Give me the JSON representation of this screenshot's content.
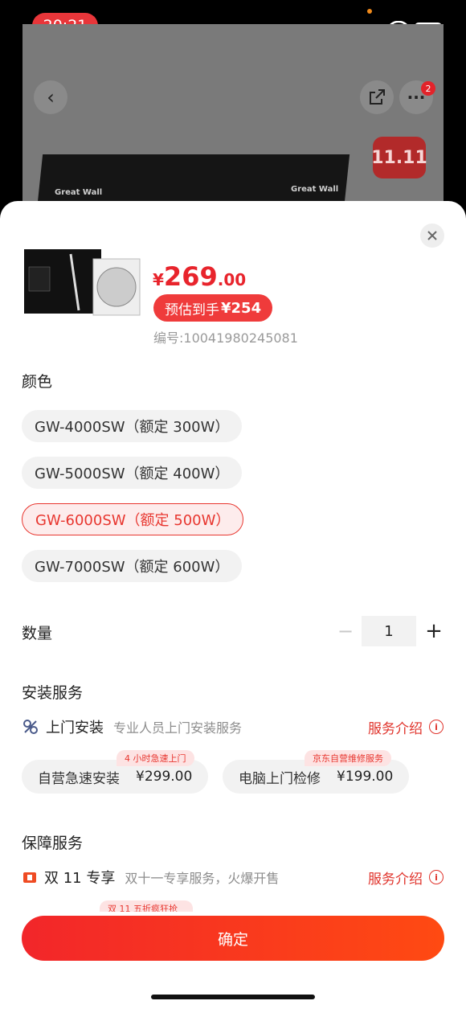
{
  "status_bar": {
    "time": "20:21"
  },
  "background_page": {
    "more_badge_count": "2",
    "promo_badge": "11.11",
    "box_brand_left": "Great Wall",
    "box_brand_right": "Great Wall"
  },
  "product": {
    "price_symbol": "¥",
    "price_integer": "269",
    "price_decimal": ".00",
    "estimate_label": "预估到手",
    "estimate_value": "¥254",
    "sku_number": "编号:10041980245081"
  },
  "color_section": {
    "title": "颜色",
    "options": [
      {
        "label": "GW-4000SW（额定 300W）",
        "selected": false
      },
      {
        "label": "GW-5000SW（额定 400W）",
        "selected": false
      },
      {
        "label": "GW-6000SW（额定 500W）",
        "selected": true
      },
      {
        "label": "GW-7000SW（额定 600W）",
        "selected": false
      }
    ]
  },
  "quantity": {
    "title": "数量",
    "value": "1",
    "minus": "−",
    "plus": "+"
  },
  "install_service": {
    "title": "安装服务",
    "icon": "install-tools-icon",
    "name": "上门安装",
    "desc": "专业人员上门安装服务",
    "link": "服务介绍",
    "options": [
      {
        "label": "自营急速安装",
        "price": "¥299.00",
        "tag": "4 小时急速上门"
      },
      {
        "label": "电脑上门检修",
        "price": "¥199.00",
        "tag": "京东自营维修服务"
      }
    ]
  },
  "guarantee_service": {
    "title": "保障服务",
    "icon": "double-11-icon",
    "name": "双 11 专享",
    "desc": "双十一专享服务，火爆开售",
    "link": "服务介绍",
    "peek_tag": "双 11 五折疯狂抢"
  },
  "confirm_button": "确定",
  "colors": {
    "accent": "#e8242c",
    "selected_bg": "#fdecec",
    "chip_bg": "#f2f2f2"
  }
}
